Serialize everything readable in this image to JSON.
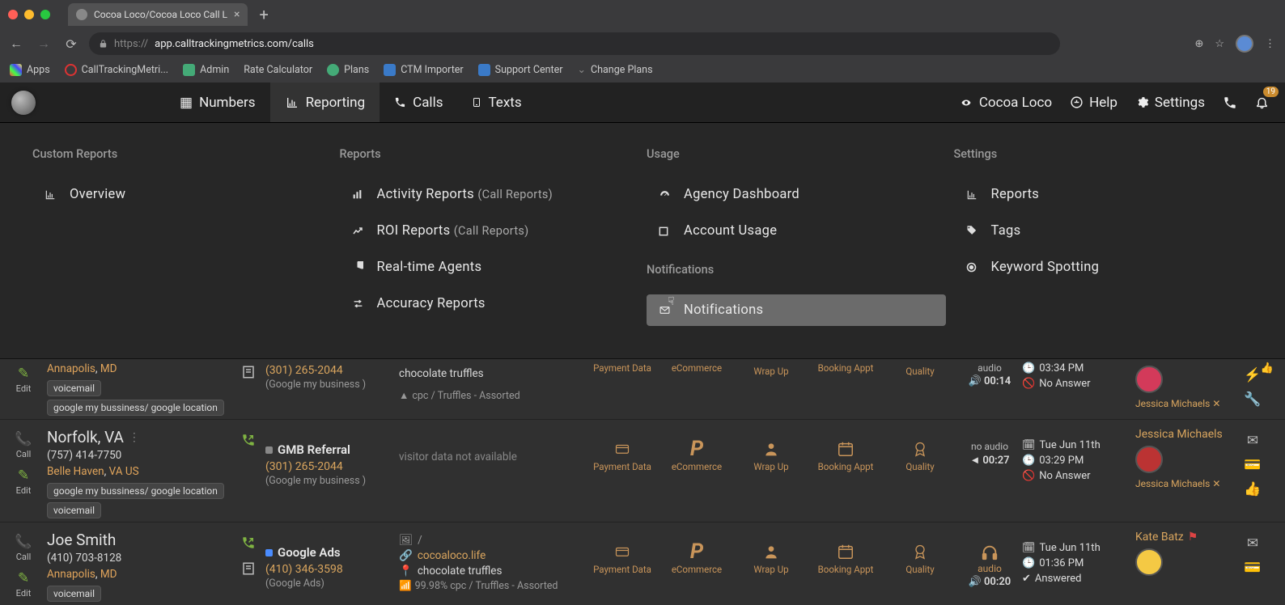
{
  "browser": {
    "tab_title": "Cocoa Loco/Cocoa Loco Call L",
    "url_display": "app.calltrackingmetrics.com/calls",
    "url_prefix": "https://",
    "bookmarks": [
      {
        "label": "Apps",
        "icon": "apps"
      },
      {
        "label": "CallTrackingMetri...",
        "icon": "ctm"
      },
      {
        "label": "Admin",
        "icon": "admin"
      },
      {
        "label": "Rate Calculator",
        "icon": "calc"
      },
      {
        "label": "Plans",
        "icon": "plan"
      },
      {
        "label": "CTM Importer",
        "icon": "ctm"
      },
      {
        "label": "Support Center",
        "icon": "ctm"
      },
      {
        "label": "Change Plans",
        "icon": "plain"
      }
    ]
  },
  "nav": {
    "items": [
      {
        "label": "Numbers",
        "icon": "grid"
      },
      {
        "label": "Reporting",
        "icon": "chart",
        "active": true
      },
      {
        "label": "Calls",
        "icon": "phone"
      },
      {
        "label": "Texts",
        "icon": "mobile"
      }
    ],
    "right": {
      "account": "Cocoa Loco",
      "help": "Help",
      "settings": "Settings",
      "bell_badge": "19"
    }
  },
  "mega": {
    "col1": {
      "heading": "Custom Reports",
      "items": [
        {
          "label": "Overview",
          "icon": "chart"
        }
      ]
    },
    "col2": {
      "heading": "Reports",
      "items": [
        {
          "label": "Activity Reports ",
          "sub": "(Call Reports)",
          "icon": "bars"
        },
        {
          "label": "ROI Reports ",
          "sub": "(Call Reports)",
          "icon": "trend"
        },
        {
          "label": "Real-time Agents",
          "icon": "pie"
        },
        {
          "label": "Accuracy Reports",
          "icon": "swap"
        }
      ]
    },
    "col3": {
      "heading": "Usage",
      "items": [
        {
          "label": "Agency Dashboard",
          "icon": "gauge"
        },
        {
          "label": "Account Usage",
          "icon": "square"
        }
      ],
      "heading2": "Notifications",
      "items2": [
        {
          "label": "Notifications",
          "icon": "mail",
          "selected": true
        }
      ]
    },
    "col4": {
      "heading": "Settings",
      "items": [
        {
          "label": "Reports",
          "icon": "bars"
        },
        {
          "label": "Tags",
          "icon": "tag"
        },
        {
          "label": "Keyword Spotting",
          "icon": "target"
        }
      ]
    }
  },
  "rows": [
    {
      "partial": true,
      "edit": "Edit",
      "caller": {
        "loc_city": "Annapolis",
        "loc_state": "MD",
        "chips": [
          "voicemail",
          "google my bussiness/ google location"
        ]
      },
      "source": {
        "phone": "(301) 265-2044",
        "sub": "(Google my business )"
      },
      "visitor": {
        "kw": "chocolate truffles",
        "extra": "cpc / Truffles - Assorted"
      },
      "metrics": [
        "Payment Data",
        "eCommerce",
        "Wrap Up",
        "Booking Appt",
        "Quality"
      ],
      "audio": {
        "label": "audio",
        "dur": "00:14",
        "type": "play"
      },
      "when": {
        "time": "03:34 PM",
        "status": "No Answer"
      },
      "who": {
        "name": "Jessica Michaels"
      }
    },
    {
      "call": "Call",
      "edit": "Edit",
      "caller": {
        "name": "Norfolk, VA",
        "phone": "(757) 414-7750",
        "loc_city": "Belle Haven",
        "loc_state": "VA US",
        "chips": [
          "google my bussiness/ google location",
          "voicemail"
        ]
      },
      "source": {
        "name": "GMB Referral",
        "phone": "(301) 265-2044",
        "sub": "(Google my business )"
      },
      "visitor": {
        "na": "visitor data not available"
      },
      "metrics": [
        "Payment Data",
        "eCommerce",
        "Wrap Up",
        "Booking Appt",
        "Quality"
      ],
      "audio": {
        "label": "no audio",
        "dur": "00:27",
        "type": "mute"
      },
      "when": {
        "date": "Tue Jun 11th",
        "time": "03:29 PM",
        "status": "No Answer"
      },
      "who": {
        "top": "Jessica Michaels",
        "name": "Jessica Michaels"
      }
    },
    {
      "call": "Call",
      "edit": "Edit",
      "caller": {
        "name": "Joe Smith",
        "phone": "(410) 703-8128",
        "loc_city": "Annapolis",
        "loc_state": "MD",
        "chips": [
          "voicemail"
        ]
      },
      "source": {
        "name": "Google Ads",
        "phone": "(410) 346-3598",
        "sub": "(Google Ads)"
      },
      "visitor": {
        "slash": "/",
        "link": "cocoaloco.life",
        "kw": "chocolate truffles",
        "pct": "99.98% cpc / Truffles - Assorted"
      },
      "metrics": [
        "Payment Data",
        "eCommerce",
        "Wrap Up",
        "Booking Appt",
        "Quality"
      ],
      "audio": {
        "label": "audio",
        "dur": "00:20",
        "type": "headphones"
      },
      "when": {
        "date": "Tue Jun 11th",
        "time": "01:36 PM",
        "status": "Answered"
      },
      "who": {
        "top": "Kate Batz"
      }
    }
  ]
}
